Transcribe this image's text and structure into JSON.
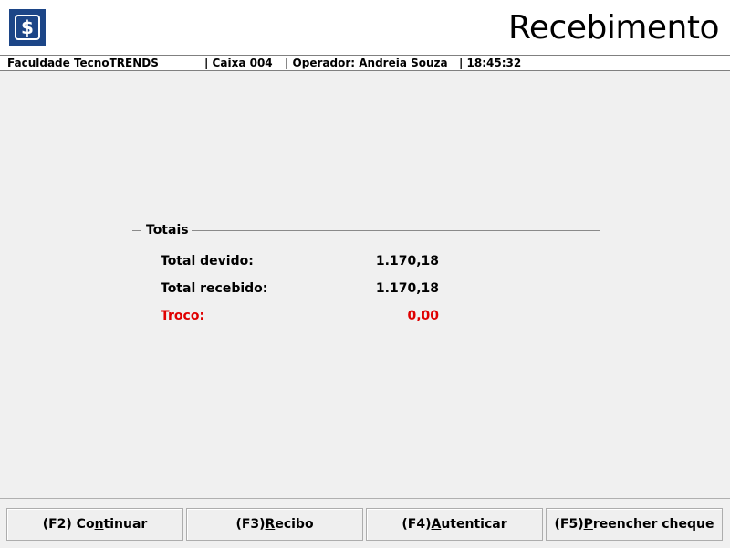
{
  "header": {
    "logo_icon": "dollar-sign-icon",
    "logo_glyph": "$",
    "title": "Recebimento"
  },
  "status": {
    "institution": "Faculdade TecnoTRENDS",
    "caixa": "| Caixa 004",
    "operador": "| Operador: Andreia Souza",
    "time": "| 18:45:32"
  },
  "totals": {
    "legend": "Totais",
    "total_devido_label": "Total devido:",
    "total_devido_value": "1.170,18",
    "total_recebido_label": "Total recebido:",
    "total_recebido_value": "1.170,18",
    "troco_label": "Troco:",
    "troco_value": "0,00",
    "troco_color": "#e00000"
  },
  "buttons": {
    "continuar": {
      "prefix": "(F2) Co",
      "accel": "n",
      "suffix": "tinuar"
    },
    "recibo": {
      "prefix": "(F3) ",
      "accel": "R",
      "suffix": "ecibo"
    },
    "autenticar": {
      "prefix": "(F4) ",
      "accel": "A",
      "suffix": "utenticar"
    },
    "cheque": {
      "prefix": "(F5) ",
      "accel": "P",
      "suffix": "reencher cheque"
    }
  },
  "colors": {
    "logo_bg": "#1c4587",
    "background": "#f0f0f0"
  }
}
